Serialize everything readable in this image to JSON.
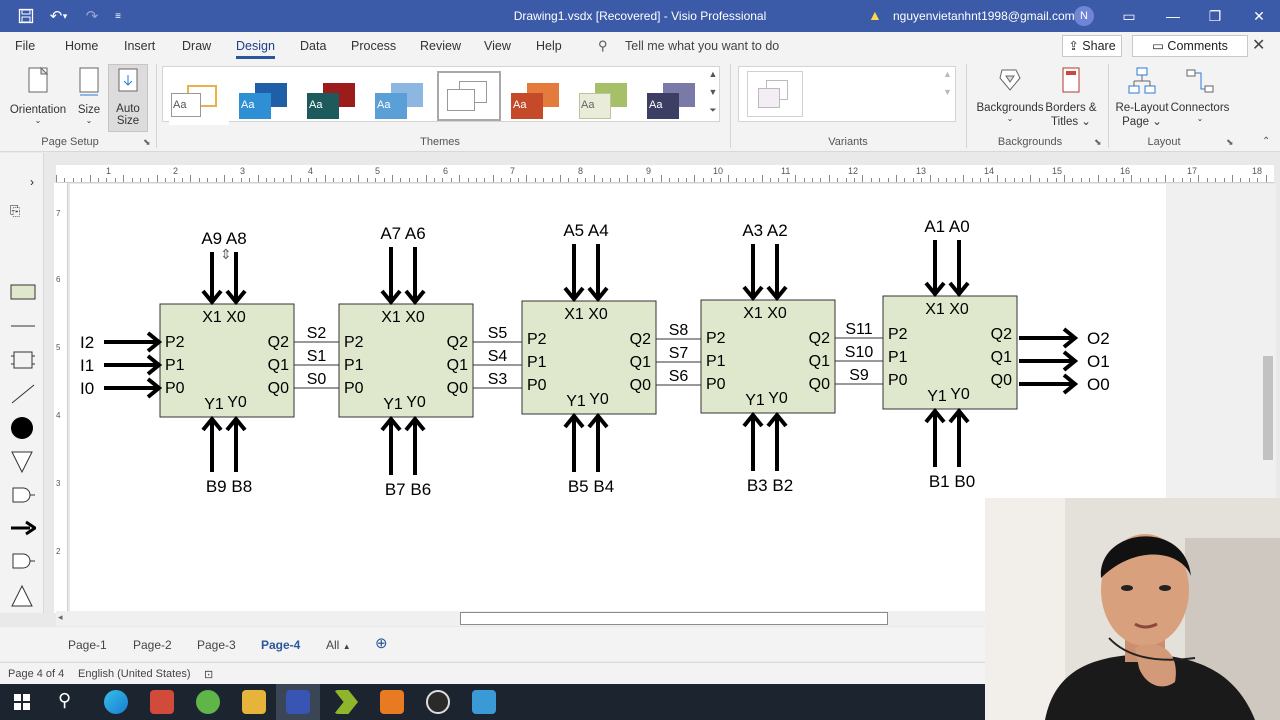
{
  "titlebar": {
    "title": "Drawing1.vsdx  [Recovered]  -  Visio Professional",
    "account": "nguyenvietanhnt1998@gmail.com",
    "avatar_initial": "N"
  },
  "menu": {
    "tabs": [
      "File",
      "Home",
      "Insert",
      "Draw",
      "Design",
      "Data",
      "Process",
      "Review",
      "View",
      "Help"
    ],
    "active": "Design",
    "tell_me": "Tell me what you want to do",
    "share": "Share",
    "comments": "Comments"
  },
  "ribbon": {
    "page_setup": {
      "orientation": "Orientation",
      "size": "Size",
      "auto_size_1": "Auto",
      "auto_size_2": "Size",
      "label": "Page Setup"
    },
    "themes_label": "Themes",
    "theme_sample": "Aa",
    "variants_label": "Variants",
    "backgrounds": {
      "backgrounds": "Backgrounds",
      "borders_1": "Borders &",
      "borders_2": "Titles",
      "label": "Backgrounds"
    },
    "layout": {
      "relayout_1": "Re-Layout",
      "relayout_2": "Page",
      "connectors": "Connectors",
      "label": "Layout"
    }
  },
  "ruler": {
    "h_ticks": [
      "1",
      "2",
      "3",
      "4",
      "5",
      "6",
      "7",
      "8",
      "9",
      "10",
      "11",
      "12",
      "13",
      "14",
      "15",
      "16",
      "17",
      "18"
    ],
    "v_ticks": [
      "7",
      "6",
      "5",
      "4",
      "3",
      "2"
    ]
  },
  "diagram": {
    "blocks": [
      {
        "top_inputs": "A9 A8",
        "bottom_inputs": "B9 B8",
        "x_label": "X1 X0",
        "y_label_1": "Y1",
        "y_label_2": "Y0",
        "p": [
          "P2",
          "P1",
          "P0"
        ],
        "q": [
          "Q2",
          "Q1",
          "Q0"
        ]
      },
      {
        "top_inputs": "A7 A6",
        "bottom_inputs": "B7 B6",
        "x_label": "X1 X0",
        "y_label_1": "Y1",
        "y_label_2": "Y0",
        "p": [
          "P2",
          "P1",
          "P0"
        ],
        "q": [
          "Q2",
          "Q1",
          "Q0"
        ]
      },
      {
        "top_inputs": "A5 A4",
        "bottom_inputs": "B5 B4",
        "x_label": "X1 X0",
        "y_label_1": "Y1",
        "y_label_2": "Y0",
        "p": [
          "P2",
          "P1",
          "P0"
        ],
        "q": [
          "Q2",
          "Q1",
          "Q0"
        ]
      },
      {
        "top_inputs": "A3 A2",
        "bottom_inputs": "B3 B2",
        "x_label": "X1 X0",
        "y_label_1": "Y1",
        "y_label_2": "Y0",
        "p": [
          "P2",
          "P1",
          "P0"
        ],
        "q": [
          "Q2",
          "Q1",
          "Q0"
        ]
      },
      {
        "top_inputs": "A1 A0",
        "bottom_inputs": "B1 B0",
        "x_label": "X1 X0",
        "y_label_1": "Y1",
        "y_label_2": "Y0",
        "p": [
          "P2",
          "P1",
          "P0"
        ],
        "q": [
          "Q2",
          "Q1",
          "Q0"
        ]
      }
    ],
    "inputs": [
      "I2",
      "I1",
      "I0"
    ],
    "signals": [
      [
        "S2",
        "S1",
        "S0"
      ],
      [
        "S5",
        "S4",
        "S3"
      ],
      [
        "S8",
        "S7",
        "S6"
      ],
      [
        "S11",
        "S10",
        "S9"
      ]
    ],
    "outputs": [
      "O2",
      "O1",
      "O0"
    ],
    "block_fill": "#dfe8cc"
  },
  "pages": {
    "tabs": [
      "Page-1",
      "Page-2",
      "Page-3",
      "Page-4"
    ],
    "active": "Page-4",
    "all": "All"
  },
  "status": {
    "page_info": "Page 4 of 4",
    "language": "English (United States)"
  }
}
